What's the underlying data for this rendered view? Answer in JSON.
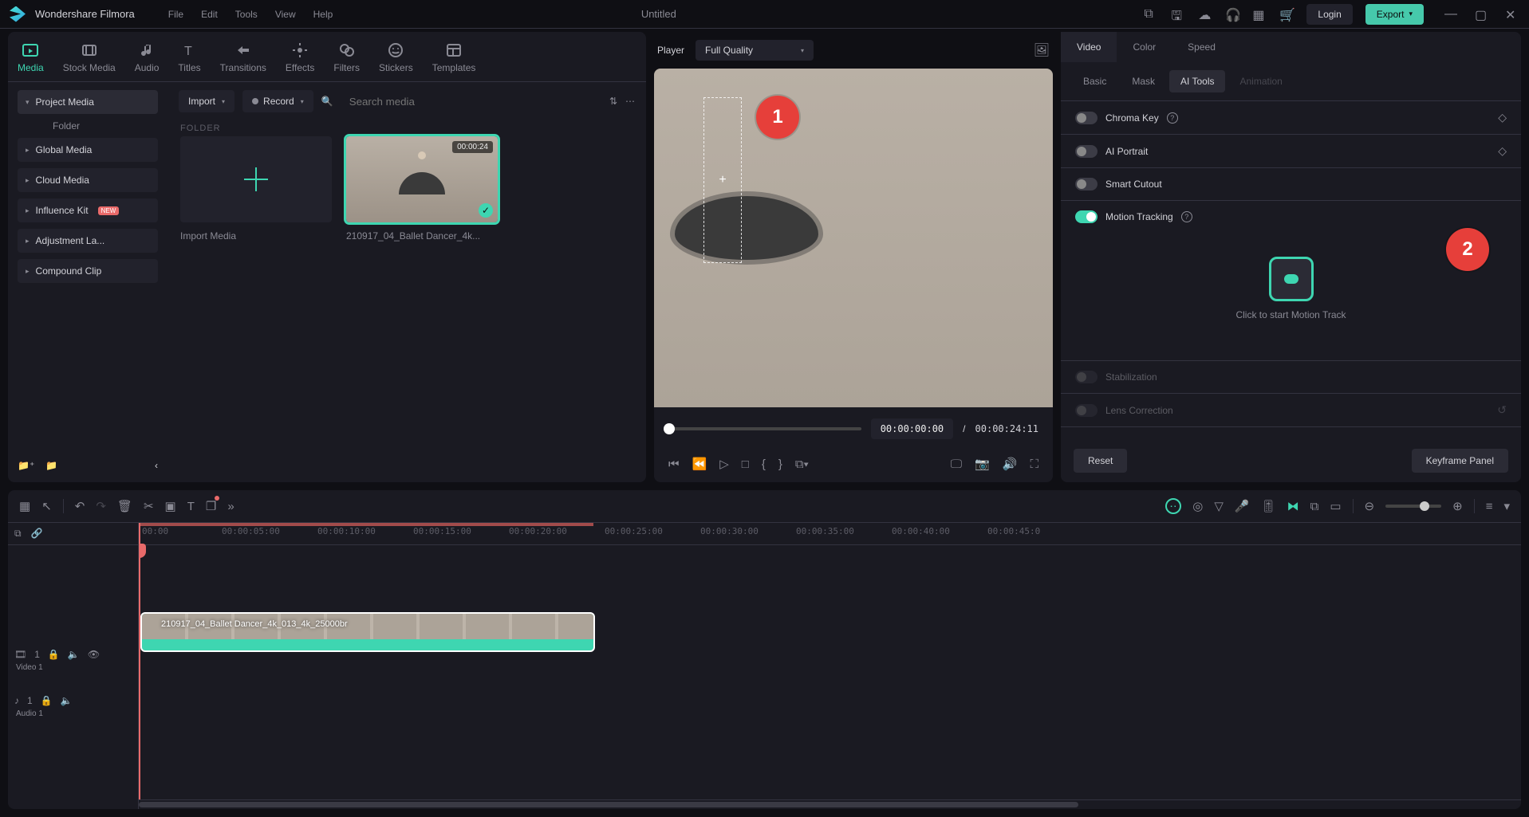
{
  "app": {
    "name": "Wondershare Filmora",
    "doc_title": "Untitled"
  },
  "menubar": [
    "File",
    "Edit",
    "Tools",
    "View",
    "Help"
  ],
  "title_right": {
    "login": "Login",
    "export": "Export"
  },
  "media_tabs": [
    {
      "key": "media",
      "label": "Media"
    },
    {
      "key": "stock",
      "label": "Stock Media"
    },
    {
      "key": "audio",
      "label": "Audio"
    },
    {
      "key": "titles",
      "label": "Titles"
    },
    {
      "key": "transitions",
      "label": "Transitions"
    },
    {
      "key": "effects",
      "label": "Effects"
    },
    {
      "key": "filters",
      "label": "Filters"
    },
    {
      "key": "stickers",
      "label": "Stickers"
    },
    {
      "key": "templates",
      "label": "Templates"
    }
  ],
  "sidebar": {
    "project_media": "Project Media",
    "folder": "Folder",
    "global_media": "Global Media",
    "cloud_media": "Cloud Media",
    "influence_kit": "Influence Kit",
    "influence_badge": "NEW",
    "adjustment": "Adjustment La...",
    "compound": "Compound Clip"
  },
  "content_toolbar": {
    "import": "Import",
    "record": "Record",
    "search_placeholder": "Search media"
  },
  "folder_section": "FOLDER",
  "media_cards": {
    "import_label": "Import Media",
    "clip_label": "210917_04_Ballet Dancer_4k...",
    "clip_duration": "00:00:24"
  },
  "player": {
    "label": "Player",
    "quality": "Full Quality",
    "current_time": "00:00:00:00",
    "sep": "/",
    "total_time": "00:00:24:11",
    "marker1": "1"
  },
  "inspector": {
    "tabs": [
      "Video",
      "Color",
      "Speed"
    ],
    "subtabs": [
      "Basic",
      "Mask",
      "AI Tools",
      "Animation"
    ],
    "chroma": "Chroma Key",
    "ai_portrait": "AI Portrait",
    "smart_cutout": "Smart Cutout",
    "motion_tracking": "Motion Tracking",
    "motion_track_cta": "Click to start Motion Track",
    "stabilization": "Stabilization",
    "lens_correction": "Lens Correction",
    "reset": "Reset",
    "keyframe_panel": "Keyframe Panel",
    "marker2": "2"
  },
  "timeline": {
    "ticks": [
      "00:00",
      "00:00:05:00",
      "00:00:10:00",
      "00:00:15:00",
      "00:00:20:00",
      "00:00:25:00",
      "00:00:30:00",
      "00:00:35:00",
      "00:00:40:00",
      "00:00:45:0"
    ],
    "video_track_index": "1",
    "video_track_label": "Video 1",
    "audio_track_index": "1",
    "audio_track_label": "Audio 1",
    "clip_label": "210917_04_Ballet Dancer_4k_013_4k_25000br"
  }
}
